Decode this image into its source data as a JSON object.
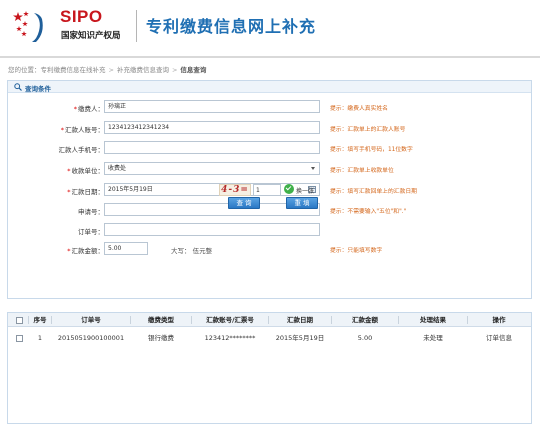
{
  "header": {
    "logo_text": "SIPO",
    "org_name": "国家知识产权局",
    "site_title": "专利缴费信息网上补充"
  },
  "breadcrumb": {
    "prefix": "您的位置：",
    "items": [
      "专利缴费信息在线补充",
      "补充缴费信息查询",
      "信息查询"
    ]
  },
  "query_panel": {
    "title": "查询条件",
    "fields": {
      "payer": {
        "label": "缴费人：",
        "required": "*",
        "value": "孙璃正",
        "hint": "提示：缴费人真实姓名"
      },
      "account": {
        "label": "汇款人账号：",
        "required": "*",
        "value": "1234123412341234",
        "hint": "提示：汇款单上的汇款人账号"
      },
      "phone": {
        "label": "汇款人手机号：",
        "value": "",
        "hint": "提示：填写手机号码，11位数字"
      },
      "receiver": {
        "label": "收款单位：",
        "required": "*",
        "value": "收费处",
        "hint": "提示：汇款单上收款单位"
      },
      "date": {
        "label": "汇款日期：",
        "required": "*",
        "value": "2015年5月19日",
        "hint": "提示：填写汇款回单上的汇款日期"
      },
      "application_no": {
        "label": "申请号：",
        "value": "",
        "hint": "提示：不需要输入\"五位\"和\".\""
      },
      "order_no": {
        "label": "订单号：",
        "value": ""
      },
      "amount": {
        "label": "汇款金额：",
        "required": "*",
        "value": "5.00",
        "uppercase_label": "大写：",
        "uppercase_value": "伍元整",
        "hint": "提示：只能填写数字"
      }
    },
    "captcha": {
      "image_text": "4-3=",
      "input_value": "1",
      "refresh_label": "换一张"
    },
    "buttons": {
      "query": "查 询",
      "reset": "重 填"
    }
  },
  "results": {
    "columns": [
      "序号",
      "订单号",
      "缴费类型",
      "汇款账号/汇票号",
      "汇款日期",
      "汇款金额",
      "处理结果",
      "操作"
    ],
    "rows": [
      {
        "index": "1",
        "order_no": "2015051900100001",
        "pay_type": "银行缴费",
        "account": "123412********",
        "date": "2015年5月19日",
        "amount": "5.00",
        "status": "未处理",
        "action": "订单信息"
      }
    ]
  },
  "colors": {
    "brand_red": "#c8161d",
    "title_blue": "#1f6fb3",
    "hint_orange": "#d4661a",
    "button_blue": "#2a78c4",
    "link_blue": "#1e6fc0"
  }
}
